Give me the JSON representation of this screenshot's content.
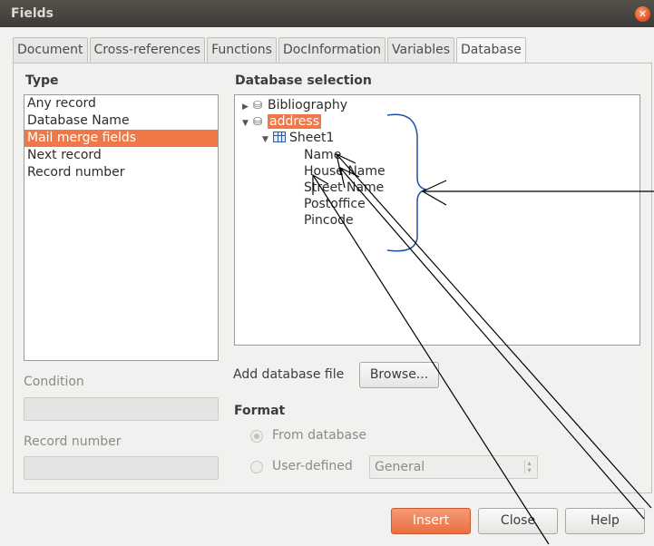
{
  "window": {
    "title": "Fields"
  },
  "tabs": [
    {
      "label": "Document"
    },
    {
      "label": "Cross-references"
    },
    {
      "label": "Functions"
    },
    {
      "label": "DocInformation"
    },
    {
      "label": "Variables"
    },
    {
      "label": "Database"
    }
  ],
  "type": {
    "label": "Type",
    "items": [
      "Any record",
      "Database Name",
      "Mail merge fields",
      "Next record",
      "Record number"
    ],
    "selected": "Mail merge fields"
  },
  "condition": {
    "label": "Condition",
    "value": ""
  },
  "record_number": {
    "label": "Record number",
    "value": ""
  },
  "database_selection": {
    "label": "Database selection",
    "tree": {
      "databases": [
        {
          "name": "Bibliography",
          "expanded": false
        },
        {
          "name": "address",
          "expanded": true,
          "highlighted": true
        }
      ],
      "table": "Sheet1",
      "fields": [
        "Name",
        "House Name",
        "Street Name",
        "Postoffice",
        "Pincode"
      ]
    }
  },
  "add_database_file": {
    "label": "Add database file",
    "browse_label": "Browse..."
  },
  "format": {
    "label": "Format",
    "from_database_label": "From database",
    "user_defined_label": "User-defined",
    "user_defined_value": "General",
    "selected": "From database"
  },
  "footer": {
    "insert_label": "Insert",
    "close_label": "Close",
    "help_label": "Help"
  },
  "icons": {
    "close": "close-icon",
    "expander": "triangle-icon",
    "database": "database-icon",
    "table": "table-icon"
  },
  "colors": {
    "accent": "#f07746",
    "annotation": "#1f4fa5"
  }
}
